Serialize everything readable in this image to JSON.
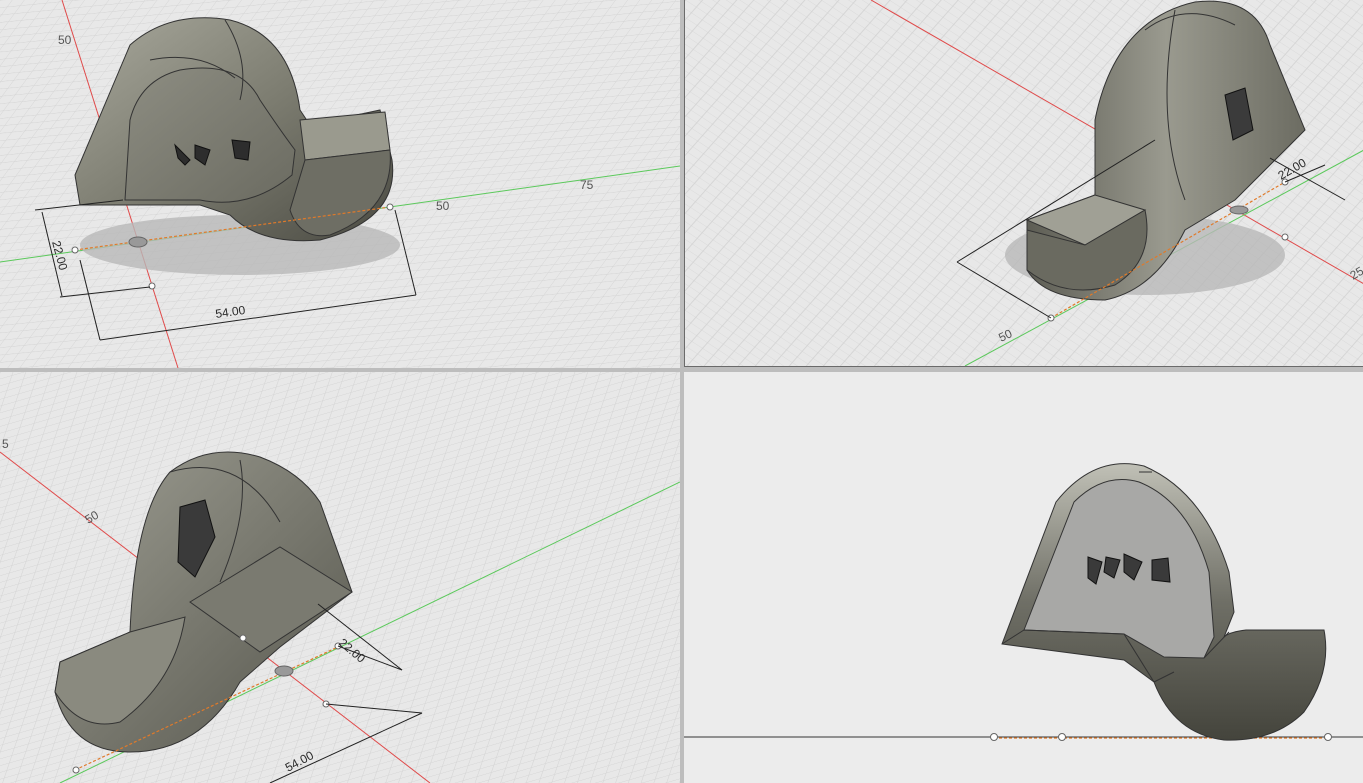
{
  "viewports": {
    "top_left": {
      "dimensions": {
        "height": "22.00",
        "width": "54.00"
      },
      "axis_ticks": {
        "red_axis": "50",
        "green_axis_1": "50",
        "green_axis_2": "75"
      }
    },
    "top_right": {
      "dimensions": {
        "height": "22.00"
      },
      "axis_ticks": {
        "green_axis": "50",
        "red_axis": "25"
      }
    },
    "bottom_left": {
      "dimensions": {
        "height": "22.00",
        "width": "54.00"
      },
      "axis_ticks": {
        "red_axis_1": "5",
        "red_axis_2": "50"
      }
    },
    "bottom_right": {
      "view": "front"
    }
  },
  "colors": {
    "canvas": "#e9e9e9",
    "grid_minor": "#d6d6d6",
    "grid_major": "#c4c4c4",
    "x_axis": "#e04a4a",
    "y_axis": "#5bc95b",
    "path": "#e07a2a",
    "body_dark": "#5a5a50",
    "body_mid": "#8c8c80",
    "body_light": "#b4b4a8"
  }
}
